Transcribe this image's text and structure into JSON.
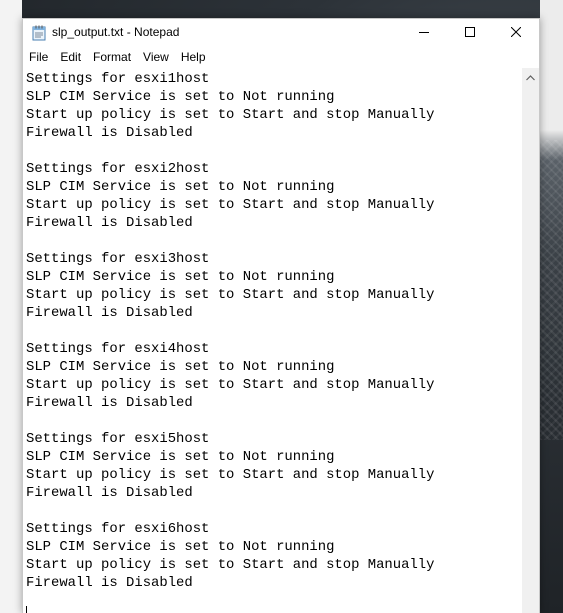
{
  "window": {
    "title": "slp_output.txt - Notepad"
  },
  "icons": {
    "app": "notepad-icon",
    "minimize": "minimize-icon",
    "maximize": "maximize-icon",
    "close": "close-icon",
    "scroll_up": "scroll-up-arrow-icon"
  },
  "menu": {
    "items": [
      {
        "label": "File"
      },
      {
        "label": "Edit"
      },
      {
        "label": "Format"
      },
      {
        "label": "View"
      },
      {
        "label": "Help"
      }
    ]
  },
  "editor": {
    "content": "Settings for esxi1host\nSLP CIM Service is set to Not running\nStart up policy is set to Start and stop Manually\nFirewall is Disabled\n\nSettings for esxi2host\nSLP CIM Service is set to Not running\nStart up policy is set to Start and stop Manually\nFirewall is Disabled\n\nSettings for esxi3host\nSLP CIM Service is set to Not running\nStart up policy is set to Start and stop Manually\nFirewall is Disabled\n\nSettings for esxi4host\nSLP CIM Service is set to Not running\nStart up policy is set to Start and stop Manually\nFirewall is Disabled\n\nSettings for esxi5host\nSLP CIM Service is set to Not running\nStart up policy is set to Start and stop Manually\nFirewall is Disabled\n\nSettings for esxi6host\nSLP CIM Service is set to Not running\nStart up policy is set to Start and stop Manually\nFirewall is Disabled"
  }
}
